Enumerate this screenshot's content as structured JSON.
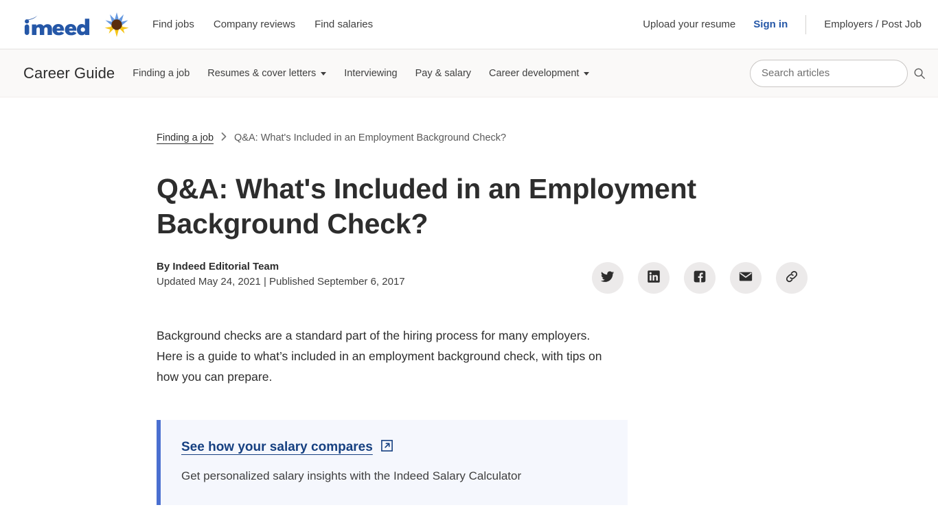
{
  "global_nav": {
    "brand": "indeed",
    "sunflower_icon": "sunflower-icon",
    "links": [
      {
        "label": "Find jobs",
        "name": "find-jobs"
      },
      {
        "label": "Company reviews",
        "name": "company-reviews"
      },
      {
        "label": "Find salaries",
        "name": "find-salaries"
      }
    ],
    "upload_resume": "Upload your resume",
    "sign_in": "Sign in",
    "employers": "Employers / Post Job",
    "sign_in_color": "#2557a7",
    "logo_color": "#2557a7"
  },
  "career_guide": {
    "title": "Career Guide",
    "links": [
      {
        "label": "Finding a job",
        "has_caret": false
      },
      {
        "label": "Resumes & cover letters",
        "has_caret": true
      },
      {
        "label": "Interviewing",
        "has_caret": false
      },
      {
        "label": "Pay & salary",
        "has_caret": false
      },
      {
        "label": "Career development",
        "has_caret": true
      }
    ],
    "search": {
      "placeholder": "Search articles",
      "value": "",
      "icon": "search-icon"
    },
    "background": "#faf9f8"
  },
  "breadcrumb": {
    "parent": "Finding a job",
    "separator": "›",
    "current": "Q&A: What's Included in an Employment Background Check?"
  },
  "article": {
    "headline": "Q&A: What's Included in an Employment Background Check?",
    "author": "By Indeed Editorial Team",
    "dates": "Updated May 24, 2021 | Published September 6, 2017",
    "lede": "Background checks are a standard part of the hiring process for many employers. Here is a guide to what’s included in an employment background check, with tips on how you can prepare.",
    "share_buttons": [
      {
        "name": "share-twitter-button",
        "icon": "twitter-icon",
        "label": "Twitter"
      },
      {
        "name": "share-linkedin-button",
        "icon": "linkedin-icon",
        "label": "LinkedIn"
      },
      {
        "name": "share-facebook-button",
        "icon": "facebook-icon",
        "label": "Facebook"
      },
      {
        "name": "share-email-button",
        "icon": "email-icon",
        "label": "Email"
      },
      {
        "name": "share-copylink-button",
        "icon": "link-icon",
        "label": "Copy link"
      }
    ]
  },
  "callout": {
    "link_text": "See how your salary compares",
    "link_icon": "external-link-icon",
    "subtitle": "Get personalized salary insights with the Indeed Salary Calculator",
    "accent_color": "#4a6fd0",
    "background": "#f5f7fd"
  }
}
